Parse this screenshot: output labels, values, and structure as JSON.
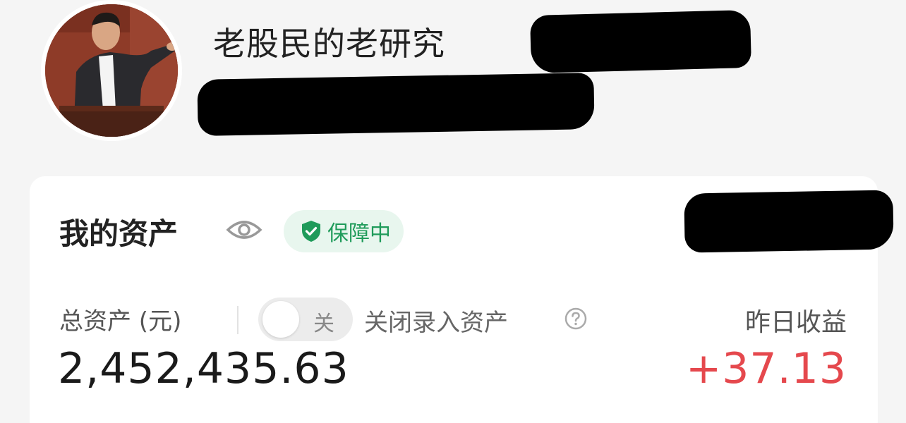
{
  "profile": {
    "username": "老股民的老研究"
  },
  "asset_card": {
    "title": "我的资产",
    "badge_label": "保障中",
    "total_label": "总资产 (元)",
    "toggle_label": "关",
    "toggle_on": false,
    "close_entry_label": "关闭录入资产",
    "yesterday_label": "昨日收益",
    "total_value": "2,452,435.63",
    "yesterday_value": "+37.13"
  },
  "icons": {
    "visibility": "eye-icon",
    "shield": "shield-check-icon",
    "help": "question-circle-icon"
  },
  "colors": {
    "badge_green": "#1f9b5a",
    "badge_bg": "#e8f6ee",
    "gain_red": "#e5484d",
    "background": "#f5f5f5"
  }
}
